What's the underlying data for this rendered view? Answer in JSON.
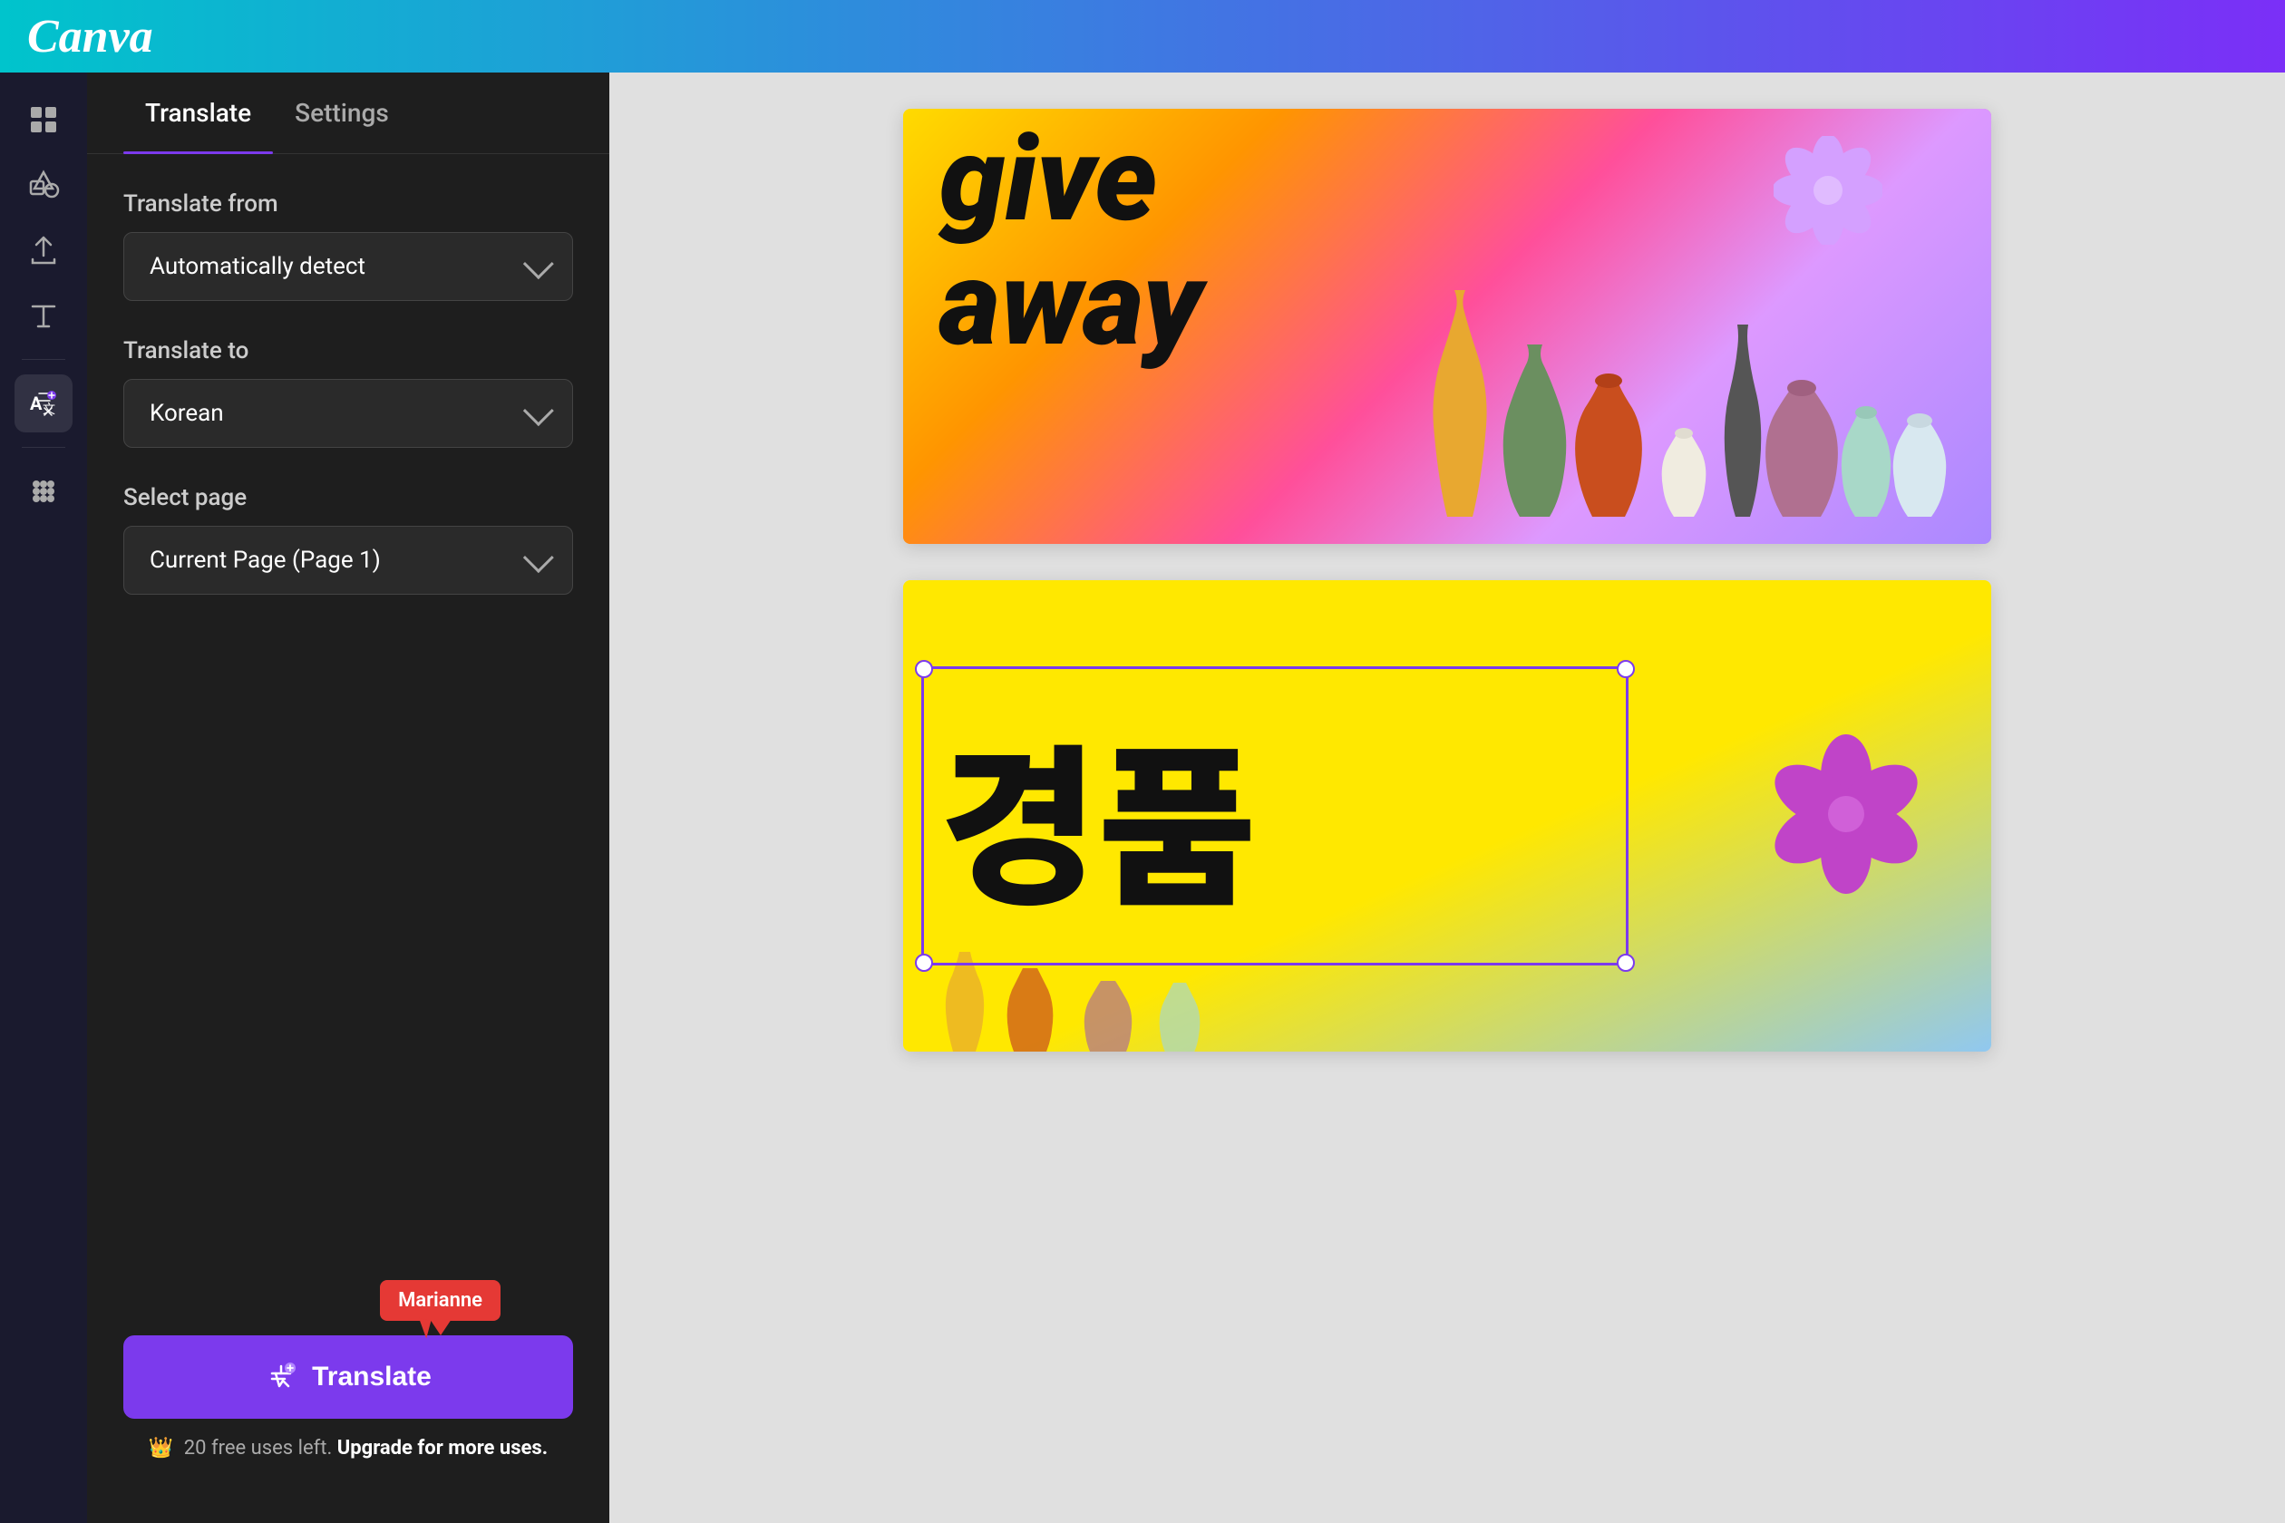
{
  "header": {
    "logo": "Canva"
  },
  "sidebar": {
    "icons": [
      {
        "name": "grid-icon",
        "symbol": "⊞",
        "active": false
      },
      {
        "name": "elements-icon",
        "symbol": "◇♡",
        "active": false
      },
      {
        "name": "upload-icon",
        "symbol": "↑",
        "active": false
      },
      {
        "name": "text-icon",
        "symbol": "T",
        "active": false
      },
      {
        "name": "translate-icon",
        "symbol": "✦A",
        "active": true
      },
      {
        "name": "apps-icon",
        "symbol": "⋯",
        "active": false
      }
    ]
  },
  "panel": {
    "tab_translate": "Translate",
    "tab_settings": "Settings",
    "active_tab": "translate",
    "translate_from_label": "Translate from",
    "translate_from_value": "Automatically detect",
    "translate_to_label": "Translate to",
    "translate_to_value": "Korean",
    "select_page_label": "Select page",
    "select_page_value": "Current Page (Page 1)",
    "user_name": "Marianne",
    "translate_button_label": "Translate",
    "free_uses_text": "20 free uses left.",
    "upgrade_text": "Upgrade for more uses."
  },
  "canvas": {
    "card1": {
      "text_line1": "give",
      "text_line2": "away"
    },
    "card2": {
      "korean_text": "경품"
    }
  },
  "colors": {
    "accent_purple": "#7c3aed",
    "header_gradient_start": "#00c4cc",
    "header_gradient_end": "#7b2ff7",
    "sidebar_bg": "#1a1a2e",
    "panel_bg": "#1e1e1e",
    "translate_btn": "#7c3aed",
    "tooltip_bg": "#e53935"
  }
}
